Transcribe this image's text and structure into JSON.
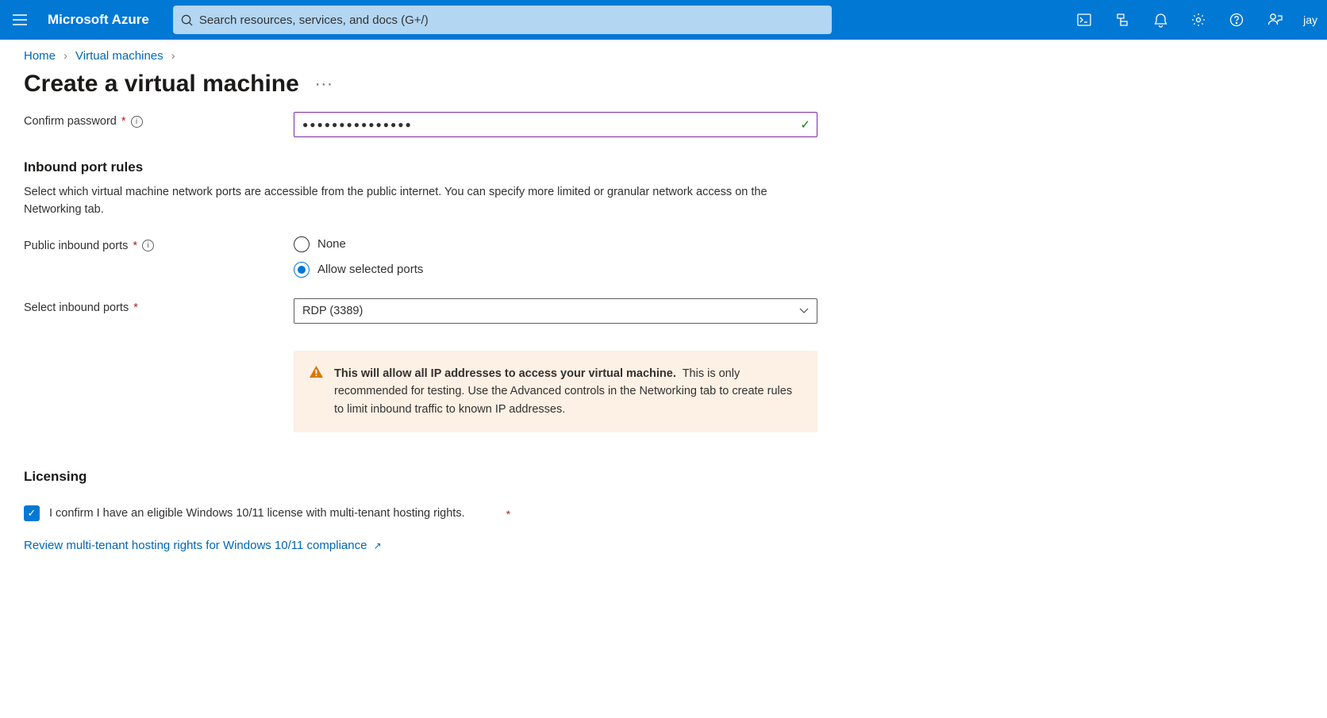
{
  "header": {
    "brand": "Microsoft Azure",
    "search_placeholder": "Search resources, services, and docs (G+/)",
    "user": "jay"
  },
  "breadcrumb": {
    "home": "Home",
    "vm": "Virtual machines"
  },
  "page": {
    "title": "Create a virtual machine"
  },
  "form": {
    "confirm_password_label": "Confirm password",
    "confirm_password_value": "●●●●●●●●●●●●●●●",
    "inbound_rules": {
      "heading": "Inbound port rules",
      "desc": "Select which virtual machine network ports are accessible from the public internet. You can specify more limited or granular network access on the Networking tab.",
      "public_ports_label": "Public inbound ports",
      "opt_none": "None",
      "opt_allow": "Allow selected ports",
      "select_ports_label": "Select inbound ports",
      "select_ports_value": "RDP (3389)",
      "warning_bold": "This will allow all IP addresses to access your virtual machine.",
      "warning_rest": "This is only recommended for testing.  Use the Advanced controls in the Networking tab to create rules to limit inbound traffic to known IP addresses."
    },
    "licensing": {
      "heading": "Licensing",
      "confirm_text": "I confirm I have an eligible Windows 10/11 license with multi-tenant hosting rights.",
      "review_link": "Review multi-tenant hosting rights for Windows 10/11 compliance"
    }
  }
}
